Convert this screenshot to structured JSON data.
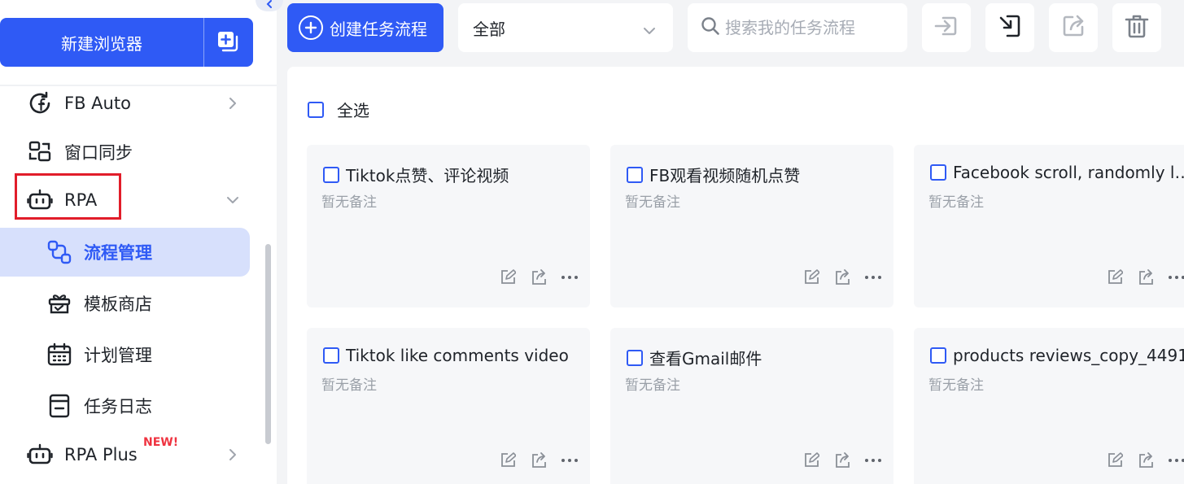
{
  "sidebar": {
    "new_browser_label": "新建浏览器",
    "items": [
      {
        "label": "FB Auto",
        "icon": "facebook-refresh-icon"
      },
      {
        "label": "窗口同步",
        "icon": "window-sync-icon"
      },
      {
        "label": "RPA",
        "icon": "robot-icon",
        "expanded": true
      },
      {
        "label": "RPA Plus",
        "icon": "robot-icon",
        "badge": "NEW!"
      }
    ],
    "rpa_sub_items": [
      {
        "label": "流程管理",
        "icon": "flow-icon",
        "active": true
      },
      {
        "label": "模板商店",
        "icon": "gift-store-icon"
      },
      {
        "label": "计划管理",
        "icon": "calendar-icon"
      },
      {
        "label": "任务日志",
        "icon": "log-icon"
      }
    ]
  },
  "toolbar": {
    "create_label": "创建任务流程",
    "filter_value": "全部",
    "search_placeholder": "搜索我的任务流程"
  },
  "main": {
    "select_all_label": "全选",
    "cards": [
      {
        "title": "Tiktok点赞、评论视频",
        "note": "暂无备注"
      },
      {
        "title": "FB观看视频随机点赞",
        "note": "暂无备注"
      },
      {
        "title": "Facebook scroll, randomly like and comment",
        "note": "暂无备注"
      },
      {
        "title": "Tiktok like comments video",
        "note": "暂无备注"
      },
      {
        "title": "查看Gmail邮件",
        "note": "暂无备注"
      },
      {
        "title": "products reviews_copy_4491",
        "note": "暂无备注"
      }
    ]
  },
  "colors": {
    "primary": "#2f5af5",
    "active_bg": "#d7e0fc",
    "highlight_border": "#e11d2a",
    "badge": "#ef3340"
  }
}
